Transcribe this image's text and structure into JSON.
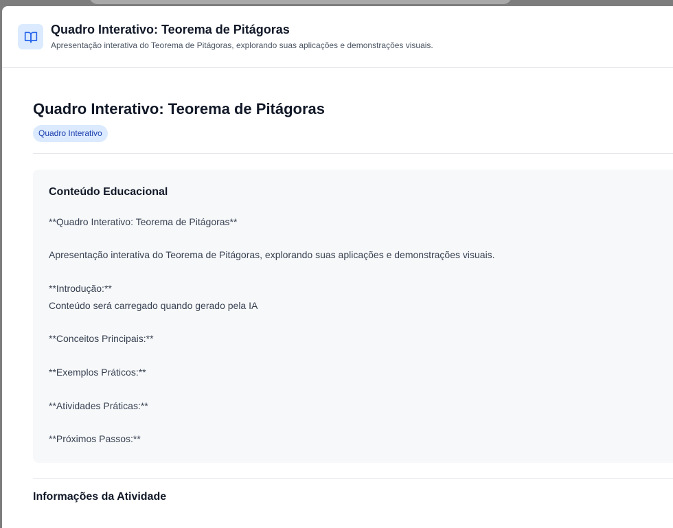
{
  "header": {
    "icon": "open-book-icon",
    "title": "Quadro Interativo: Teorema de Pitágoras",
    "subtitle": "Apresentação interativa do Teorema de Pitágoras, explorando suas aplicações e demonstrações visuais."
  },
  "main": {
    "title": "Quadro Interativo: Teorema de Pitágoras",
    "badge": "Quadro Interativo",
    "content_card": {
      "title": "Conteúdo Educacional",
      "lines": [
        "**Quadro Interativo: Teorema de Pitágoras**",
        "Apresentação interativa do Teorema de Pitágoras, explorando suas aplicações e demonstrações visuais.",
        "**Introdução:**",
        "Conteúdo será carregado quando gerado pela IA",
        "**Conceitos Principais:**",
        "**Exemplos Práticos:**",
        "**Atividades Práticas:**",
        "**Próximos Passos:**"
      ]
    },
    "info_section_title": "Informações da Atividade"
  },
  "colors": {
    "accent": "#2563eb",
    "badge_bg": "#dbeafe",
    "badge_text": "#1e40af",
    "card_bg": "#f7f8fa",
    "overlay": "#7d7d7d"
  }
}
